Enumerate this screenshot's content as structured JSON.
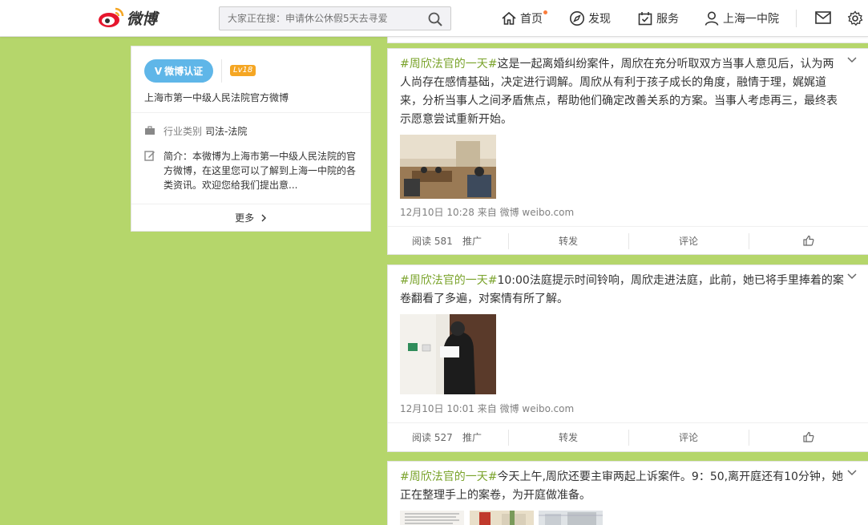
{
  "topbar": {
    "logo_text": "微博",
    "search_placeholder": "大家正在搜：申请休公休假5天去寻爱",
    "nav": [
      "首页",
      "发现",
      "服务",
      "上海一中院"
    ],
    "colors": {
      "accent": "#fa7d3c",
      "background": "#b5d66b"
    },
    "icons": [
      "weibo-logo-icon",
      "search-icon",
      "home-icon",
      "compass-icon",
      "service-icon",
      "user-icon",
      "mail-icon",
      "gear-icon"
    ]
  },
  "profile": {
    "verified_label": "微博认证",
    "level": "Lv18",
    "name": "上海市第一中级人民法院官方微博",
    "industry_label": "行业类别",
    "industry_value": "司法-法院",
    "intro_label": "简介：",
    "intro_text": "本微博为上海市第一中级人民法院的官方微博，在这里您可以了解到上海一中院的各类资讯。欢迎您给我们提出意...",
    "more_label": "更多"
  },
  "posts": [
    {
      "tag": "#周欣法官的一天#",
      "text": "这是一起离婚纠纷案件，周欣在充分听取双方当事人意见后，认为两人尚存在感情基础，决定进行调解。周欣从有利于孩子成长的角度，融情于理，娓娓道来，分析当事人之间矛盾焦点，帮助他们确定改善关系的方案。当事人考虑再三，最终表示愿意尝试重新开始。",
      "time": "12月10日 10:28",
      "source_prefix": "来自",
      "source": "微博 weibo.com",
      "read_label": "阅读",
      "read_count": "581",
      "promote": "推广",
      "repost": "转发",
      "comment": "评论"
    },
    {
      "tag": "#周欣法官的一天#",
      "text": "10:00法庭提示时间铃响，周欣走进法庭，此前，她已将手里捧着的案卷翻看了多遍，对案情有所了解。",
      "time": "12月10日 10:01",
      "source_prefix": "来自",
      "source": "微博 weibo.com",
      "read_label": "阅读",
      "read_count": "527",
      "promote": "推广",
      "repost": "转发",
      "comment": "评论"
    },
    {
      "tag": "#周欣法官的一天#",
      "text": "今天上午,周欣还要主审两起上诉案件。9：50,离开庭还有10分钟，她正在整理手上的案卷，为开庭做准备。"
    }
  ]
}
